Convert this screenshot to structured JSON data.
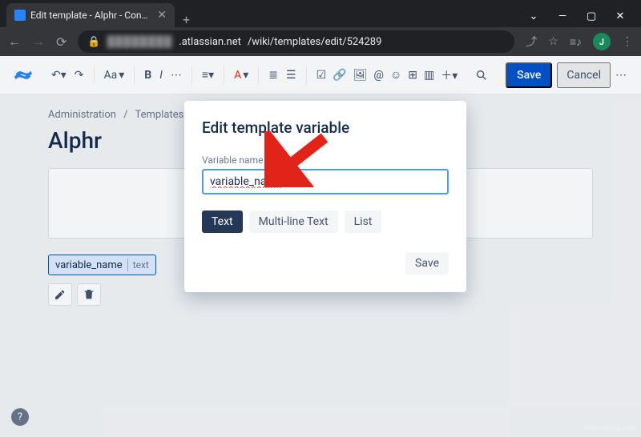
{
  "browser": {
    "tab_title": "Edit template - Alphr - Confluenc",
    "url_host": ".atlassian.net",
    "url_path": "/wiki/templates/edit/524289",
    "avatar_letter": "J"
  },
  "toolbar": {
    "text_style": "Aa",
    "save_label": "Save",
    "cancel_label": "Cancel"
  },
  "breadcrumb": {
    "root": "Administration",
    "separator": "/",
    "current": "Templates"
  },
  "page": {
    "title": "Alphr"
  },
  "chip": {
    "name": "variable_name",
    "type": "text"
  },
  "modal": {
    "title": "Edit template variable",
    "field_label": "Variable name",
    "field_value": "variable_name",
    "tabs": {
      "text": "Text",
      "multiline": "Multi-line Text",
      "list": "List"
    },
    "save_label": "Save"
  },
  "watermark": "www.deuaq.com"
}
